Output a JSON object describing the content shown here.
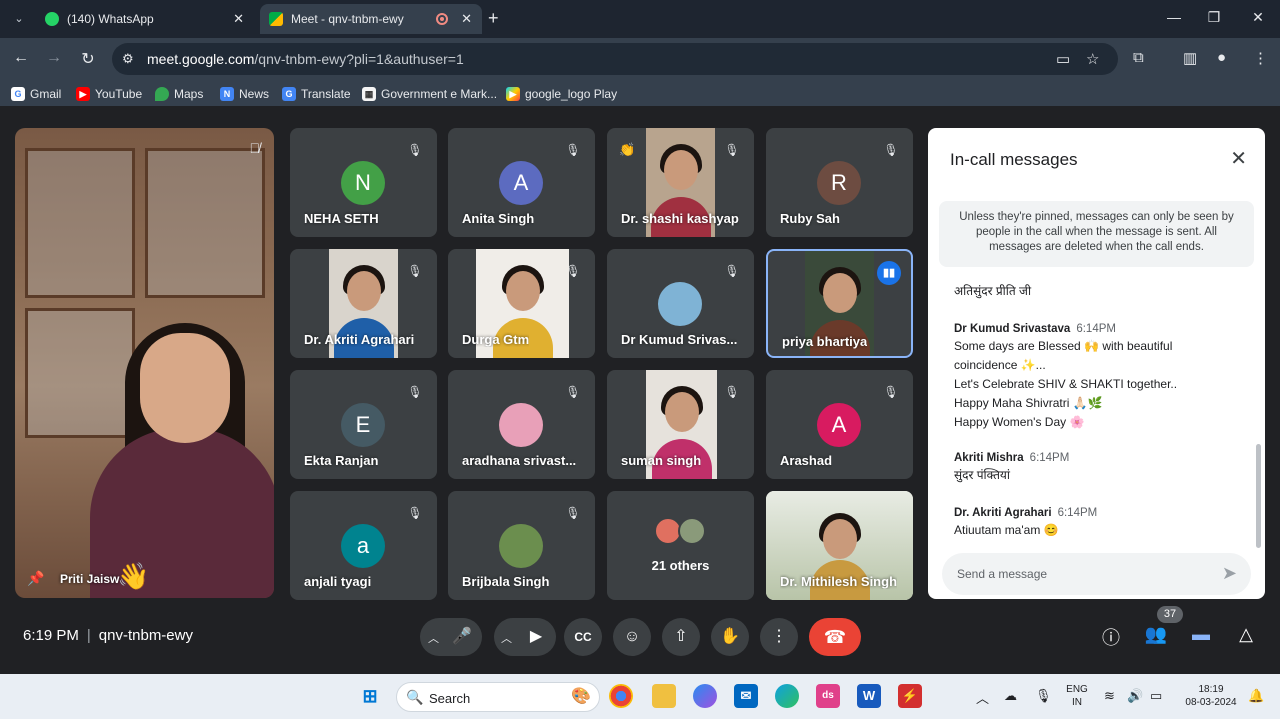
{
  "browser": {
    "tabs": [
      {
        "title": "(140) WhatsApp",
        "favicon_badge": "99+"
      },
      {
        "title": "Meet - qnv-tnbm-ewy"
      }
    ],
    "url_host": "meet.google.com",
    "url_path": "/qnv-tnbm-ewy?pli=1&authuser=1",
    "bookmarks": [
      "Gmail",
      "YouTube",
      "Maps",
      "News",
      "Translate",
      "Government e Mark...",
      "google_logo Play"
    ]
  },
  "meet": {
    "self": {
      "name": "Priti Jaisw"
    },
    "tiles": [
      {
        "name": "NEHA SETH",
        "initial": "N",
        "color": "#43a047"
      },
      {
        "name": "Anita Singh",
        "initial": "A",
        "color": "#5c6bc0"
      },
      {
        "name": "Dr. shashi kashyap"
      },
      {
        "name": "Ruby Sah",
        "initial": "R",
        "color": "#6d4c41"
      },
      {
        "name": "Dr. Akriti Agrahari"
      },
      {
        "name": "Durga Gtm"
      },
      {
        "name": "Dr Kumud Srivas..."
      },
      {
        "name": "priya bhartiya"
      },
      {
        "name": "Ekta Ranjan",
        "initial": "E",
        "color": "#455a64"
      },
      {
        "name": "aradhana srivast..."
      },
      {
        "name": "suman singh"
      },
      {
        "name": "Arashad",
        "initial": "A",
        "color": "#d81b60"
      },
      {
        "name": "anjali tyagi",
        "initial": "a",
        "color": "#00838f"
      },
      {
        "name": "Brijbala Singh"
      },
      {
        "name": "21 others"
      },
      {
        "name": "Dr. Mithilesh Singh"
      }
    ],
    "time": "6:19 PM",
    "meeting_code": "qnv-tnbm-ewy",
    "people_count": "37"
  },
  "chat": {
    "title": "In-call messages",
    "notice": "Unless they're pinned, messages can only be seen by people in the call when the message is sent. All messages are deleted when the call ends.",
    "first_line": "अतिसुंदर प्रीति जी",
    "messages": [
      {
        "sender": "Dr Kumud Srivastava",
        "time": "6:14PM",
        "lines": [
          "Some days are Blessed 🙌 with beautiful",
          "coincidence ✨...",
          "Let's Celebrate SHIV & SHAKTI together..",
          "Happy Maha Shivratri 🙏🏻🌿",
          "Happy Women's Day 🌸"
        ]
      },
      {
        "sender": "Akriti Mishra",
        "time": "6:14PM",
        "lines": [
          "सुंदर पंक्तियां"
        ]
      },
      {
        "sender": "Dr. Akriti Agrahari",
        "time": "6:14PM",
        "lines": [
          "Atiuutam ma'am 😊"
        ]
      }
    ],
    "input_placeholder": "Send a message"
  },
  "taskbar": {
    "search_label": "Search",
    "lang_top": "ENG",
    "lang_bottom": "IN",
    "clock_time": "18:19",
    "clock_date": "08-03-2024"
  }
}
